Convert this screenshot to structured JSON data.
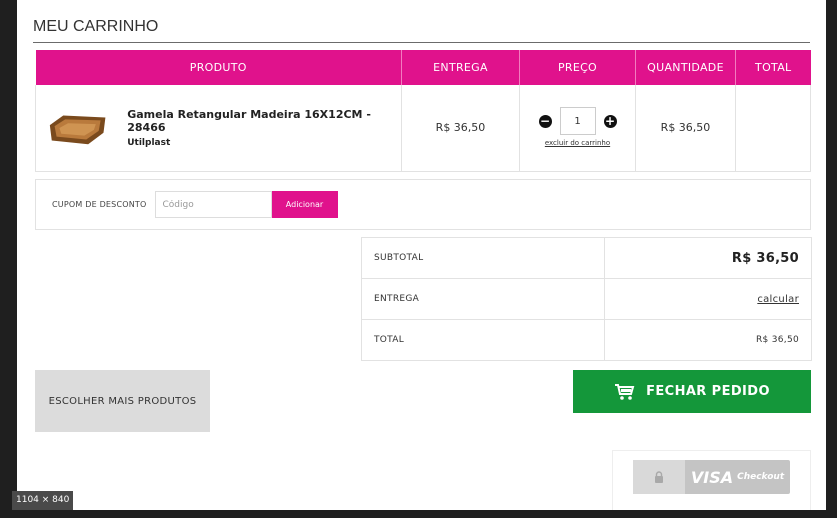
{
  "page": {
    "title": "MEU CARRINHO"
  },
  "cart": {
    "headers": {
      "product": "PRODUTO",
      "delivery": "ENTREGA",
      "price": "PREÇO",
      "quantity": "QUANTIDADE",
      "total": "TOTAL"
    },
    "item": {
      "name": "Gamela Retangular Madeira 16X12CM - 28466",
      "brand": "Utilplast",
      "delivery": "R$ 36,50",
      "quantity": "1",
      "remove_label": "excluir do carrinho",
      "price": "R$ 36,50",
      "total": ""
    }
  },
  "coupon": {
    "label": "CUPOM DE DESCONTO",
    "placeholder": "Código",
    "button": "Adicionar"
  },
  "totals": {
    "subtotal_label": "SUBTOTAL",
    "subtotal_value": "R$ 36,50",
    "delivery_label": "ENTREGA",
    "delivery_value": "calcular",
    "total_label": "TOTAL",
    "total_value": "R$ 36,50"
  },
  "actions": {
    "more_products": "ESCOLHER MAIS PRODUTOS",
    "checkout": "FECHAR PEDIDO"
  },
  "visa": {
    "brand": "VISA",
    "suffix": "Checkout"
  },
  "badge": {
    "size": "1104 × 840"
  },
  "colors": {
    "accent": "#e0128c",
    "checkout": "#14973a",
    "visa_bg": "#c4c4c4"
  },
  "icons": {
    "qty_decrease": "minus-circle-icon",
    "qty_increase": "plus-circle-icon",
    "checkout": "shopping-cart-icon",
    "visa_lock": "lock-icon"
  }
}
